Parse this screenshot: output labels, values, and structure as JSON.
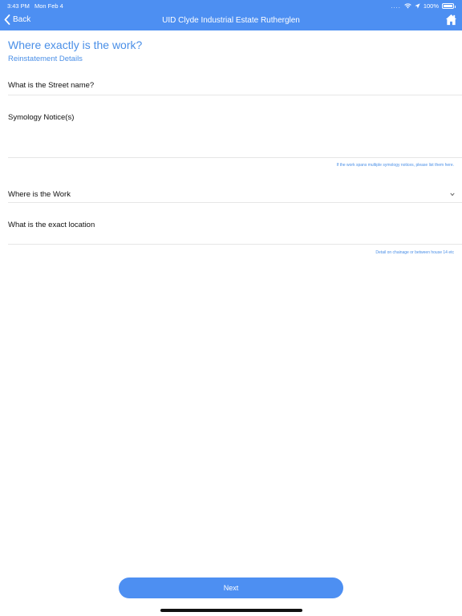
{
  "status_bar": {
    "time": "3:43 PM",
    "date": "Mon Feb 4",
    "dots": "....",
    "battery": "100%",
    "battery_level": 1.0
  },
  "nav": {
    "back_label": "Back",
    "title": "UID Clyde Industrial Estate Rutherglen"
  },
  "header": {
    "title": "Where exactly is the work?",
    "subtitle": "Reinstatement Details"
  },
  "fields": {
    "street_name": {
      "label": "What is the Street name?",
      "value": ""
    },
    "symology": {
      "label": "Symology Notice(s)",
      "value": "",
      "hint": "If the work spans multiple symology notices, please list them here."
    },
    "where_work": {
      "label": "Where is the Work",
      "value": ""
    },
    "exact_location": {
      "label": "What is the exact location",
      "value": "",
      "hint": "Detail on chainage or between house 14 etc"
    }
  },
  "footer": {
    "next_label": "Next"
  },
  "colors": {
    "accent": "#4d8ff2",
    "link": "#4a8fe7",
    "divider": "#e6e6e6"
  },
  "icons": {
    "back": "chevron-left-icon",
    "home": "home-icon",
    "dropdown": "chevron-down-icon",
    "wifi": "wifi-icon",
    "location": "location-arrow-icon",
    "battery": "battery-icon"
  }
}
